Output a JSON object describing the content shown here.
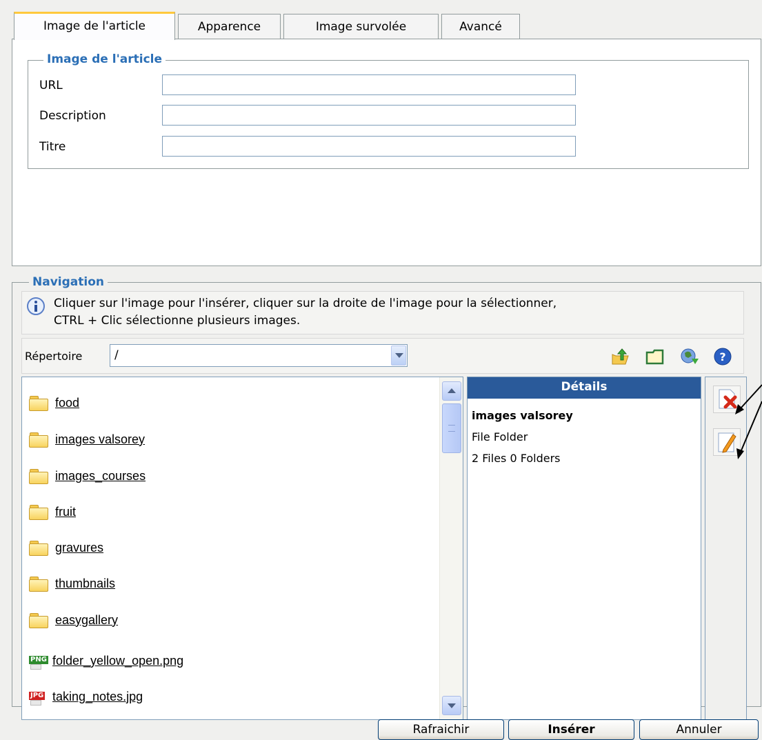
{
  "tabs": [
    {
      "label": "Image de l'article",
      "active": true
    },
    {
      "label": "Apparence",
      "active": false
    },
    {
      "label": "Image survolée",
      "active": false
    },
    {
      "label": "Avancé",
      "active": false
    }
  ],
  "image_section": {
    "legend": "Image de l'article",
    "url_label": "URL",
    "url_value": "",
    "description_label": "Description",
    "description_value": "",
    "title_label": "Titre",
    "title_value": ""
  },
  "navigation": {
    "legend": "Navigation",
    "info_line1": "Cliquer sur l'image pour l'insérer, cliquer sur la droite de l'image pour la sélectionner,",
    "info_line2": "CTRL + Clic sélectionne plusieurs images.",
    "directory_label": "Répertoire",
    "directory_value": "/",
    "toolbar_icons": [
      "folder-up-icon",
      "new-folder-icon",
      "refresh-icon",
      "help-icon"
    ],
    "folders": [
      "food",
      "images valsorey",
      "images_courses",
      "fruit",
      "gravures",
      "thumbnails",
      "easygallery"
    ],
    "files": [
      {
        "name": "folder_yellow_open.png",
        "type": "PNG",
        "color": "#2e8b2e"
      },
      {
        "name": "taking_notes.jpg",
        "type": "JPG",
        "color": "#d02020"
      }
    ]
  },
  "details": {
    "header": "Détails",
    "name": "images valsorey",
    "type": "File Folder",
    "summary": "2 Files 0 Folders"
  },
  "actions": {
    "icons": [
      "delete-icon",
      "rename-icon"
    ]
  },
  "buttons": {
    "refresh": "Rafraichir",
    "insert": "Insérer",
    "cancel": "Annuler"
  },
  "colors": {
    "legend": "#2b6fb6",
    "details_header": "#2a5a9a",
    "active_tab_accent": "#ffc83c"
  }
}
